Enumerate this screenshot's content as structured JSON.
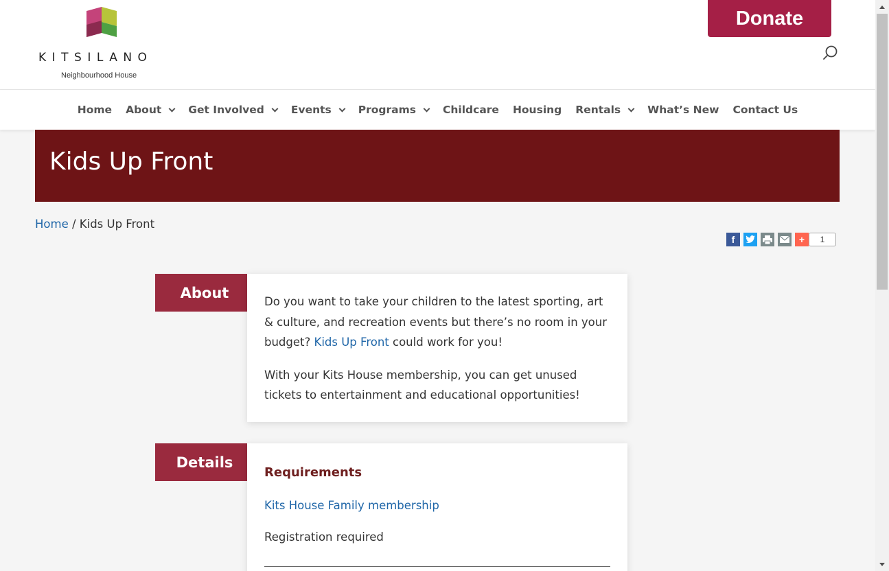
{
  "brand": {
    "name": "KITSILANO",
    "subtitle": "Neighbourhood House",
    "colors": {
      "primary": "#a51f46",
      "banner": "#6e1416",
      "tag": "#9a2a3e",
      "link": "#1f66a8"
    }
  },
  "header": {
    "donate_label": "Donate",
    "search_icon": "search-icon"
  },
  "nav": {
    "items": [
      {
        "label": "Home",
        "has_dropdown": false
      },
      {
        "label": "About",
        "has_dropdown": true
      },
      {
        "label": "Get Involved",
        "has_dropdown": true
      },
      {
        "label": "Events",
        "has_dropdown": true
      },
      {
        "label": "Programs",
        "has_dropdown": true
      },
      {
        "label": "Childcare",
        "has_dropdown": false
      },
      {
        "label": "Housing",
        "has_dropdown": false
      },
      {
        "label": "Rentals",
        "has_dropdown": true
      },
      {
        "label": "What’s New",
        "has_dropdown": false
      },
      {
        "label": "Contact Us",
        "has_dropdown": false
      }
    ]
  },
  "banner": {
    "title": "Kids Up Front"
  },
  "breadcrumb": {
    "home": "Home",
    "separator": " / ",
    "current": "Kids Up Front"
  },
  "share": {
    "icons": [
      "facebook-icon",
      "twitter-icon",
      "print-icon",
      "email-icon",
      "plus-icon"
    ],
    "count": "1"
  },
  "about": {
    "tag": "About",
    "p1_before": "Do you want to take your children to the latest sporting, art & culture, and recreation events but there’s no room in your budget? ",
    "p1_link": "Kids Up Front",
    "p1_after": " could work for you!",
    "p2": "With your Kits House membership, you can get unused tickets to entertainment and educational opportunities!"
  },
  "details": {
    "tag": "Details",
    "heading": "Requirements",
    "membership_link": "Kits House Family membership",
    "registration": "Registration required"
  }
}
